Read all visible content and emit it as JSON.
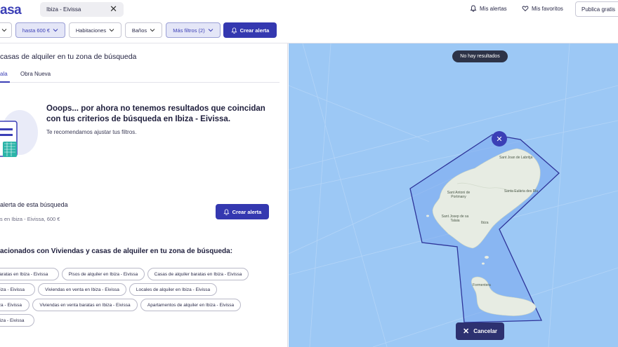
{
  "header": {
    "logo": "asa",
    "search_value": "Ibiza - Eivissa",
    "my_alerts": "Mis alertas",
    "my_favorites": "Mis favoritos",
    "publish": "Publica gratis"
  },
  "filters": {
    "price": "hasta 600 €",
    "rooms": "Habitaciones",
    "baths": "Baños",
    "more": "Más filtros (2)",
    "create_alert": "Crear alerta"
  },
  "results": {
    "title": "casas de alquiler en tu zona de búsqueda",
    "tabs": [
      "ala",
      "Obra Nueva"
    ],
    "empty_title": "Ooops... por ahora no tenemos resultados que coincidan con tus criterios de búsqueda en Ibiza - Eivissa.",
    "empty_subtitle": "Te recomendamos ajustar tus filtros."
  },
  "alert": {
    "title": "alerta de esta búsqueda",
    "subtitle": "s en Ibiza - Eivissa, 600 €",
    "button": "Crear alerta"
  },
  "related": {
    "title": "acionados con Viviendas y casas de alquiler en tu zona de búsqueda:",
    "links": [
      "baratas en Ibiza - Eivissa",
      "Pisos de alquiler en Ibiza - Eivissa",
      "Casas de alquiler baratas en Ibiza - Eivissa",
      "Ibiza - Eivissa",
      "Viviendas en venta en Ibiza - Eivissa",
      "Locales de alquiler en Ibiza - Eivissa",
      "Ibiza - Eivissa",
      "Viviendas en venta baratas en Ibiza - Eivissa",
      "Apartamentos de alquiler en Ibiza - Eivissa",
      "Ibiza - Eivissa"
    ]
  },
  "map": {
    "no_results": "No hay resultados",
    "cancel": "Cancelar",
    "labels": [
      "Sant Josep de sa Talaia",
      "Sant Antoni de Portmany",
      "Santa Eulària des Riu",
      "Sant Josep de sa Talaia",
      "Ibiza",
      "Formentera",
      "Sant Joan de Labritja"
    ]
  },
  "colors": {
    "brand": "#3438b0",
    "map_water": "#9cc8f5",
    "land": "#e7ece3"
  }
}
